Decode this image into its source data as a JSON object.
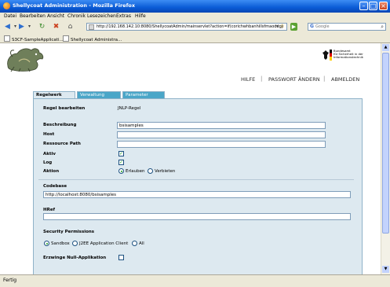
{
  "window": {
    "title": "Shellycoat Administration - Mozilla Firefox"
  },
  "menu": [
    "Datei",
    "Bearbeiten",
    "Ansicht",
    "Chronik",
    "Lesezeichen",
    "Extras",
    "Hilfe"
  ],
  "address": {
    "url": "http://192.168.142.10:8080/ShellycoatAdmin/mainservlet?action=if(corichwhbanhillsfmaoddgjnwetg"
  },
  "search": {
    "placeholder": "Google"
  },
  "bookmarks": [
    "S3CF-SampleApplicati...",
    "Shellycoat Administra..."
  ],
  "header": {
    "bsi_lines": [
      "Bundesamt",
      "für Sicherheit in der",
      "Informationstechnik"
    ],
    "nav": {
      "help": "HILFE",
      "change_password": "PASSWORT ÄNDERN",
      "logout": "ABMELDEN"
    },
    "separator": "|"
  },
  "tabs": {
    "rule": "Regelwerk",
    "admin": "Verwaltung",
    "params": "Parameter"
  },
  "form": {
    "edit_rule_label": "Regel bearbeiten",
    "edit_rule_value": "JNLP-Regel",
    "description_label": "Beschreibung",
    "description_value": "bsisamples",
    "host_label": "Host",
    "host_value": "",
    "resource_path_label": "Ressource Path",
    "resource_path_value": "",
    "active_label": "Aktiv",
    "log_label": "Log",
    "action_label": "Aktion",
    "action_allow": "Erlauben",
    "action_deny": "Verbieten",
    "codebase_label": "Codebase",
    "codebase_value": "http://localhost:8080/bsisamples",
    "href_label": "HRef",
    "href_value": "",
    "security_label": "Security Permissions",
    "perm_sandbox": "Sandbox",
    "perm_j2ee": "J2EE Application Client",
    "perm_all": "All",
    "force_null_label": "Erzwinge Null-Applikation"
  },
  "status": {
    "text": "Fertig"
  }
}
